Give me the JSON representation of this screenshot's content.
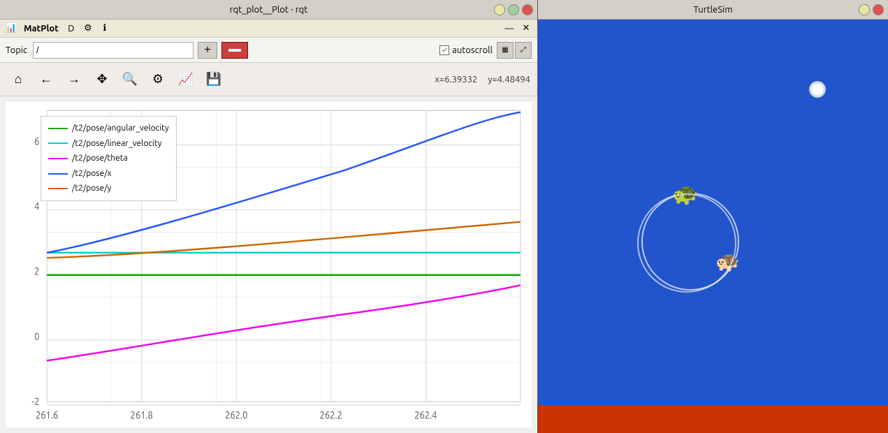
{
  "left_window": {
    "title": "rqt_plot__Plot - rqt",
    "menu_logo": "MatPlot",
    "topic_label": "Topic",
    "topic_value": "/",
    "topic_placeholder": "/",
    "add_btn_label": "+",
    "autoscroll_label": "autoscroll",
    "autoscroll_checked": true,
    "coords": {
      "x_label": "x=6.39332",
      "y_label": "y=4.48494"
    },
    "legend": [
      {
        "id": "angular_velocity",
        "label": "/t2/pose/angular_velocity",
        "color": "#00aa00"
      },
      {
        "id": "linear_velocity",
        "label": "/t2/pose/linear_velocity",
        "color": "#00cccc"
      },
      {
        "id": "theta",
        "label": "/t2/pose/theta",
        "color": "#ee00ee"
      },
      {
        "id": "x",
        "label": "/t2/pose/x",
        "color": "#2255ff"
      },
      {
        "id": "y",
        "label": "/t2/pose/y",
        "color": "#cc6600"
      }
    ],
    "x_axis": {
      "ticks": [
        "261.6",
        "261.8",
        "262.0",
        "262.2",
        "262.4"
      ]
    },
    "y_axis": {
      "ticks": [
        "-2",
        "0",
        "2",
        "4",
        "6"
      ]
    }
  },
  "right_window": {
    "title": "TurtleSim"
  },
  "icons": {
    "home": "⌂",
    "back": "←",
    "forward": "→",
    "pan": "✥",
    "zoom": "🔍",
    "config": "⚙",
    "lines": "📈",
    "save": "💾",
    "grid": "▦",
    "expand": "⤢"
  }
}
